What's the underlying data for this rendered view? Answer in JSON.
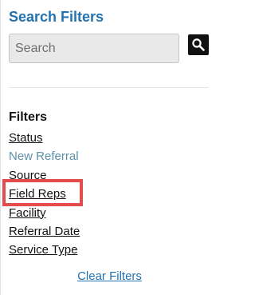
{
  "panel": {
    "title": "Search Filters"
  },
  "search": {
    "placeholder": "Search",
    "value": ""
  },
  "filters": {
    "heading": "Filters",
    "items": [
      {
        "label": "Status",
        "style": "link"
      },
      {
        "label": "New Referral",
        "style": "muted"
      },
      {
        "label": "Source",
        "style": "plain"
      },
      {
        "label": "Field Reps",
        "style": "link",
        "highlighted": true
      },
      {
        "label": "Facility",
        "style": "link"
      },
      {
        "label": "Referral Date",
        "style": "link"
      },
      {
        "label": "Service Type",
        "style": "link"
      }
    ]
  },
  "actions": {
    "clear_label": "Clear Filters"
  },
  "colors": {
    "title": "#2472ae",
    "muted_text": "#5d8fa8",
    "highlight": "#e34d4d",
    "search_button": "#111111"
  },
  "icons": {
    "search": "magnifier-icon"
  }
}
